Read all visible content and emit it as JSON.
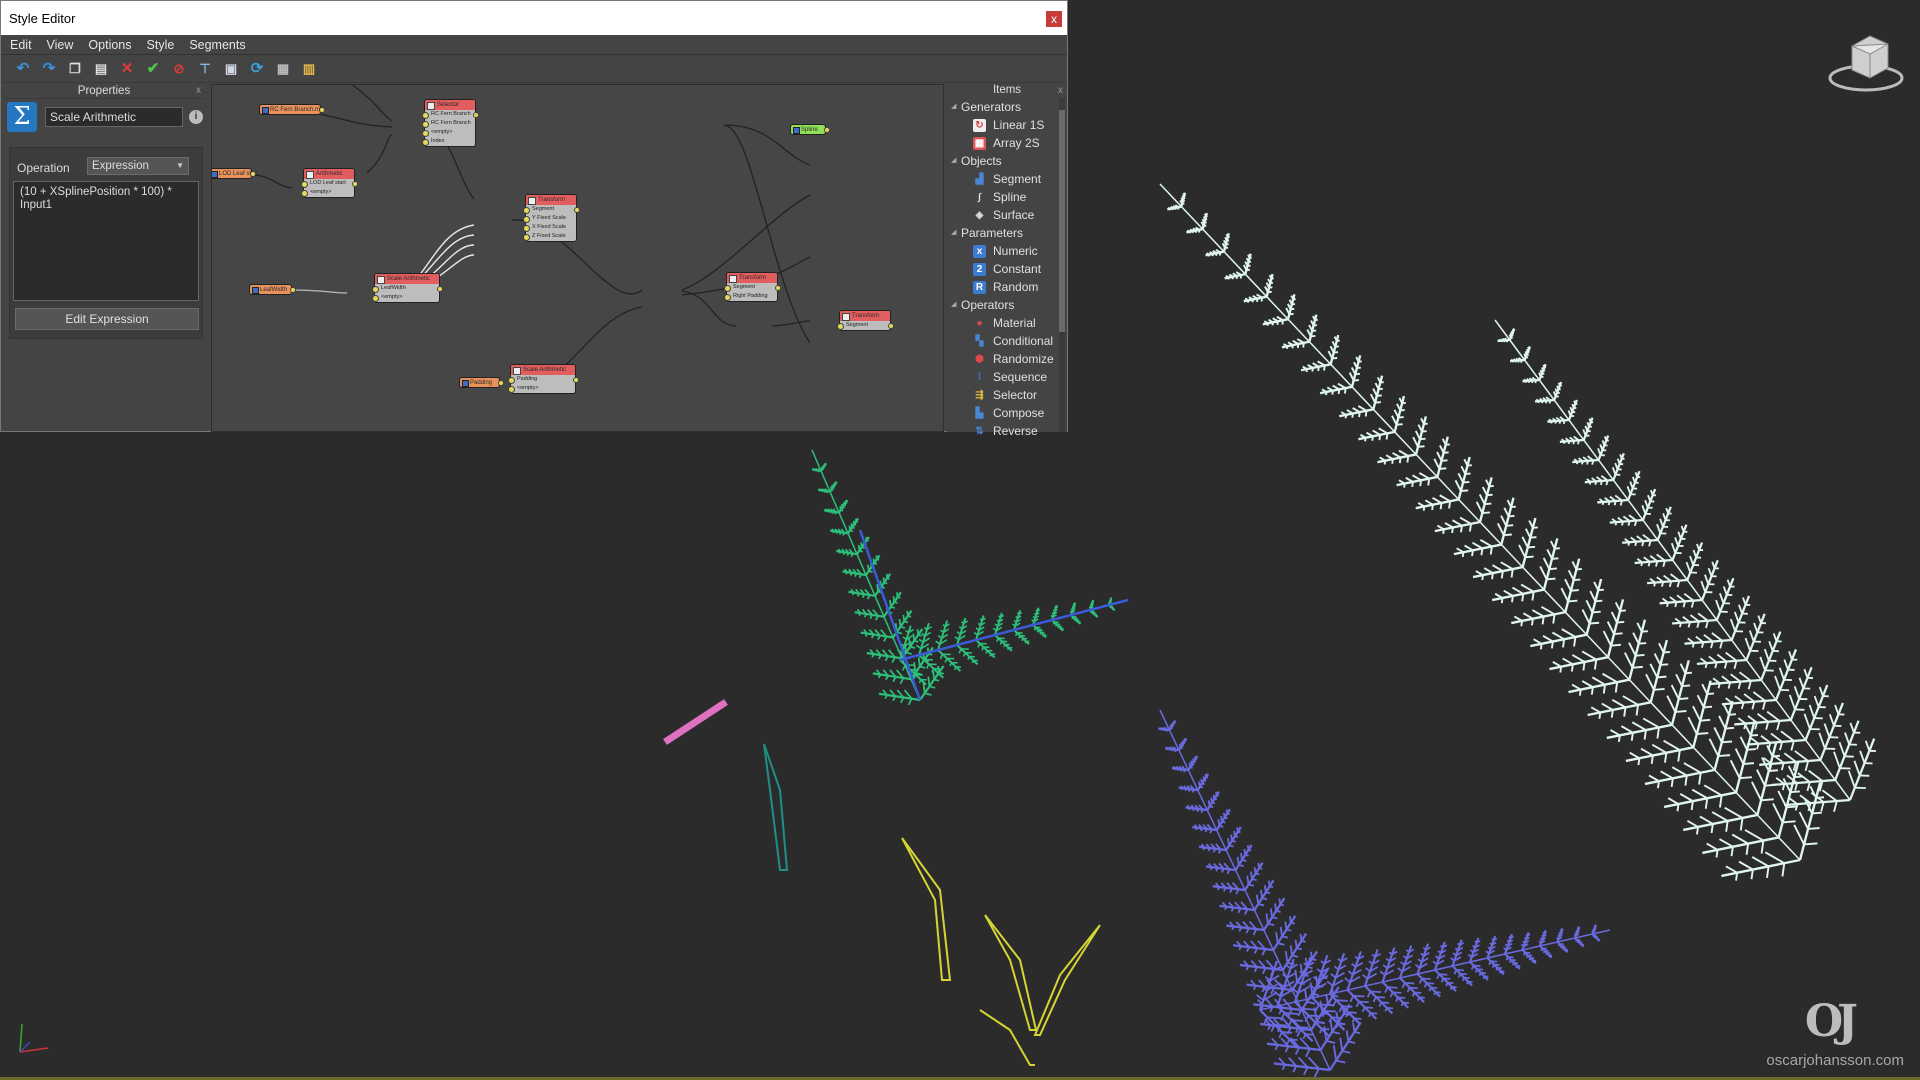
{
  "window": {
    "title": "Style Editor",
    "close": "x"
  },
  "menu": [
    "Edit",
    "View",
    "Options",
    "Style",
    "Segments"
  ],
  "toolbar_icons": [
    "undo-icon",
    "redo-icon",
    "copy-icon",
    "paste-icon",
    "delete-icon",
    "apply-icon",
    "stop-icon",
    "filter-icon",
    "collapse-icon",
    "refresh-icon",
    "save-icon",
    "layout-icon"
  ],
  "properties": {
    "header": "Properties",
    "close": "x",
    "node_name": "Scale Arithmetic",
    "operation_label": "Operation",
    "operation_value": "Expression",
    "expression": "(10 + XSplinePosition * 100) * Input1",
    "edit_button": "Edit Expression"
  },
  "graph": {
    "params": [
      {
        "label": "RC Fern Branch.mdl",
        "color": "orange"
      },
      {
        "label": "LOD Leaf start",
        "color": "orange"
      },
      {
        "label": "LeafWidth",
        "color": "orange"
      },
      {
        "label": "Padding",
        "color": "orange"
      },
      {
        "label": "Spline",
        "color": "green"
      }
    ],
    "nodes": [
      {
        "title": "Selector",
        "ports": [
          "RC Fern Branch",
          "RC Fern Branch",
          "<empty>",
          "Index"
        ]
      },
      {
        "title": "Arithmetic",
        "ports": [
          "LOD Leaf start",
          "<empty>"
        ]
      },
      {
        "title": "Transform",
        "ports": [
          "Segment",
          "Y Fixed Scale",
          "X Fixed Scale",
          "Z Fixed Scale"
        ]
      },
      {
        "title": "Scale Arithmetic",
        "ports": [
          "LeafWidth",
          "<empty>"
        ]
      },
      {
        "title": "Transform",
        "ports": [
          "Segment",
          "Right Padding"
        ]
      },
      {
        "title": "Transform",
        "ports": [
          "Segment"
        ]
      },
      {
        "title": "Scale Arithmetic",
        "ports": [
          "Padding",
          "<empty>"
        ]
      }
    ]
  },
  "items": {
    "header": "Items",
    "close": "x",
    "categories": [
      {
        "name": "Generators",
        "items": [
          {
            "label": "Linear 1S",
            "icon": "linear-icon"
          },
          {
            "label": "Array 2S",
            "icon": "array-icon"
          }
        ]
      },
      {
        "name": "Objects",
        "items": [
          {
            "label": "Segment",
            "icon": "segment-icon"
          },
          {
            "label": "Spline",
            "icon": "spline-icon"
          },
          {
            "label": "Surface",
            "icon": "surface-icon"
          }
        ]
      },
      {
        "name": "Parameters",
        "items": [
          {
            "label": "Numeric",
            "icon": "numeric-icon"
          },
          {
            "label": "Constant",
            "icon": "constant-icon"
          },
          {
            "label": "Random",
            "icon": "random-icon"
          }
        ]
      },
      {
        "name": "Operators",
        "items": [
          {
            "label": "Material",
            "icon": "material-icon"
          },
          {
            "label": "Conditional",
            "icon": "conditional-icon"
          },
          {
            "label": "Randomize",
            "icon": "randomize-icon"
          },
          {
            "label": "Sequence",
            "icon": "sequence-icon"
          },
          {
            "label": "Selector",
            "icon": "selector-icon"
          },
          {
            "label": "Compose",
            "icon": "compose-icon"
          },
          {
            "label": "Reverse",
            "icon": "reverse-icon"
          }
        ]
      }
    ]
  },
  "viewport": {
    "logo": "OJ",
    "url": "oscarjohansson.com",
    "viewcube": "HOME"
  }
}
